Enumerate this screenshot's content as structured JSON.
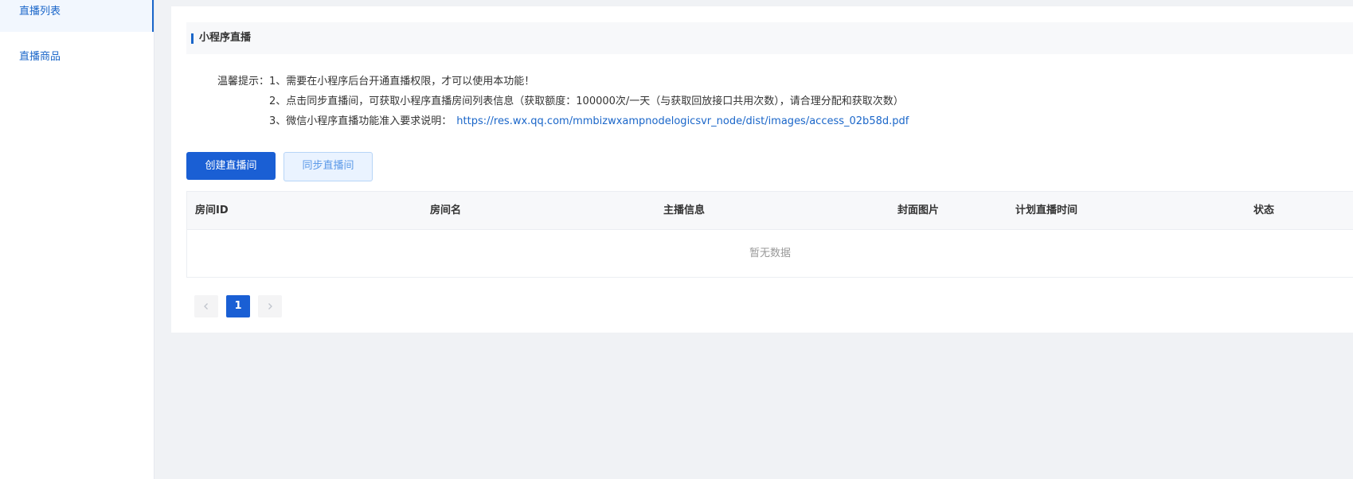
{
  "sidebar": {
    "items": [
      {
        "label": "直播列表"
      },
      {
        "label": "直播商品"
      }
    ]
  },
  "section": {
    "title": "小程序直播"
  },
  "tips": {
    "label": "温馨提示：",
    "line1": "1、需要在小程序后台开通直播权限，才可以使用本功能！",
    "line2": "2、点击同步直播间，可获取小程序直播房间列表信息（获取额度：100000次/一天（与获取回放接口共用次数），请合理分配和获取次数）",
    "line3_prefix": "3、微信小程序直播功能准入要求说明：",
    "line3_link": "https://res.wx.qq.com/mmbizwxampnodelogicsvr_node/dist/images/access_02b58d.pdf"
  },
  "buttons": {
    "create": "创建直播间",
    "sync": "同步直播间"
  },
  "table": {
    "columns": [
      "房间ID",
      "房间名",
      "主播信息",
      "封面图片",
      "计划直播时间",
      "状态"
    ],
    "empty_text": "暂无数据"
  },
  "pagination": {
    "prev_icon": "chevron-left-icon",
    "current_page": "1",
    "next_icon": "chevron-right-icon"
  },
  "colors": {
    "primary": "#1a5fd4",
    "link": "#1a66c9",
    "background": "#f0f2f5"
  }
}
